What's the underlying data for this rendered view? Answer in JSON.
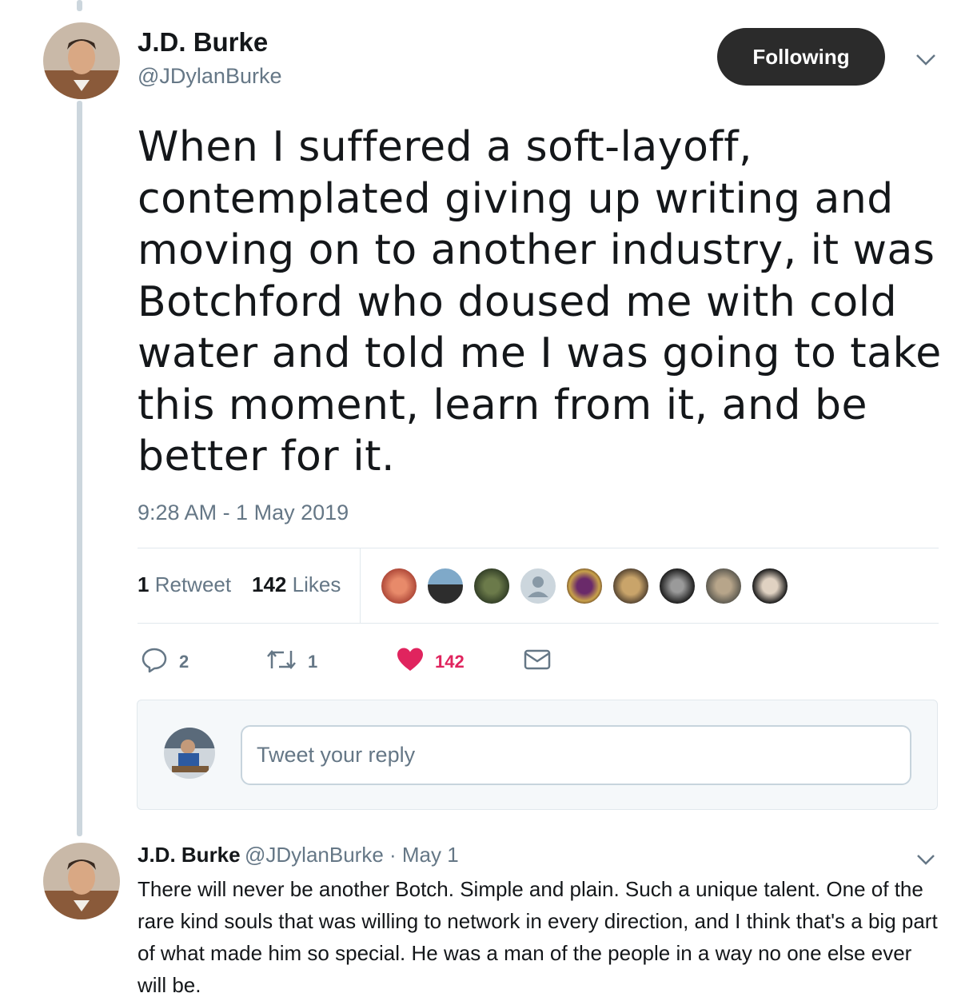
{
  "tweet": {
    "author_name": "J.D. Burke",
    "author_handle": "@JDylanBurke",
    "follow_label": "Following",
    "text": "When I suffered a soft-layoff, contemplated giving up writing and moving on to another industry, it was Botchford who doused me with cold water and told me I was going to take this moment, learn from it, and be better for it.",
    "timestamp": "9:28 AM - 1 May 2019",
    "stats": {
      "retweets_count": "1",
      "retweets_label": "Retweet",
      "likes_count": "142",
      "likes_label": "Likes"
    },
    "actions": {
      "reply_count": "2",
      "retweet_count": "1",
      "like_count": "142"
    }
  },
  "reply_composer": {
    "placeholder": "Tweet your reply"
  },
  "next_reply": {
    "author_name": "J.D. Burke",
    "meta": "@JDylanBurke · May 1",
    "text": "There will never be another Botch. Simple and plain. Such a unique talent. One of the rare kind souls that was willing to network in every direction, and I think that's a big part of what made him so special. He was a man of the people in a way no one else ever will be."
  },
  "colors": {
    "text_primary": "#14171a",
    "text_secondary": "#657786",
    "like_red": "#e0245e",
    "follow_button_bg": "#2b2b2b"
  }
}
